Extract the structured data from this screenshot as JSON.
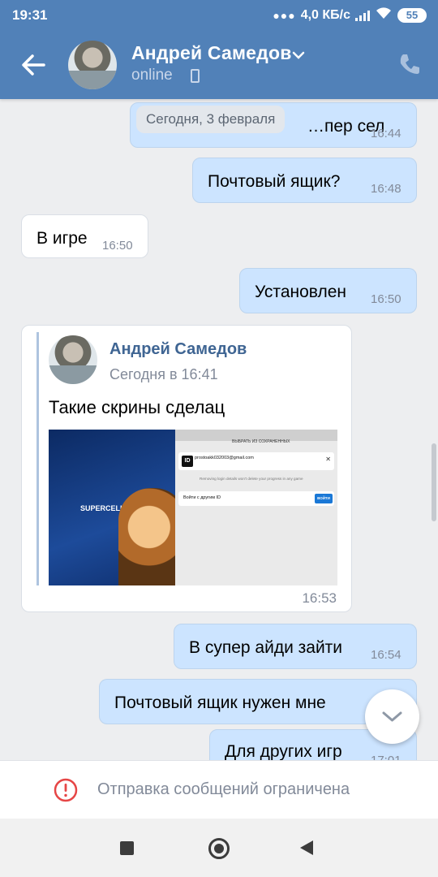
{
  "status_bar": {
    "time": "19:31",
    "speed": "4,0 КБ/с",
    "battery": "55"
  },
  "header": {
    "name": "Андрей Самедов",
    "status": "online"
  },
  "date_separator": "Сегодня, 3 февраля",
  "messages": [
    {
      "dir": "out",
      "text": "…пер сел",
      "time": "16:44"
    },
    {
      "dir": "out",
      "text": "Почтовый ящик?",
      "time": "16:48"
    },
    {
      "dir": "in",
      "text": "В игре",
      "time": "16:50"
    },
    {
      "dir": "out",
      "text": "Установлен",
      "time": "16:50"
    },
    {
      "dir": "out",
      "text": "В супер айди зайти",
      "time": "16:54"
    },
    {
      "dir": "out",
      "text": "Почтовый ящик нужен мне",
      "time": ""
    },
    {
      "dir": "out",
      "text": "Для других игр",
      "time": "17:01"
    }
  ],
  "forwarded": {
    "author": "Андрей Самедов",
    "when": "Сегодня в 16:41",
    "text": "Такие скрины сделац",
    "time": "16:53",
    "screenshot": {
      "logo": "SUPERCELL",
      "logo_badge": "ID",
      "header": "ВЫБРАТЬ ИЗ СОХРАНЕННЫХ",
      "account_badge": "ID",
      "email": "prostoakk032003@gmail.com",
      "note": "Removing login details won't delete your progress in any game",
      "login_label": "Войти с другим ID",
      "login_button": "ВОЙТИ"
    }
  },
  "restriction": {
    "text": "Отправка сообщений ограничена"
  },
  "colors": {
    "header": "#5181b8",
    "outgoing": "#cce4ff",
    "incoming": "#ffffff",
    "background": "#edeef0",
    "warning": "#e64646"
  }
}
